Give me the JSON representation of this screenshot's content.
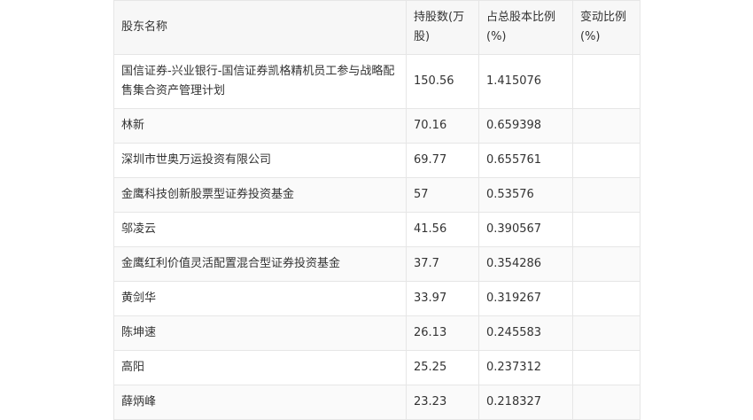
{
  "table": {
    "headers": [
      "股东名称",
      "持股数(万股)",
      "占总股本比例(%)",
      "变动比例(%)"
    ],
    "rows": [
      [
        "国信证券-兴业银行-国信证券凯格精机员工参与战略配售集合资产管理计划",
        "150.56",
        "1.415076",
        ""
      ],
      [
        "林新",
        "70.16",
        "0.659398",
        ""
      ],
      [
        "深圳市世奥万运投资有限公司",
        "69.77",
        "0.655761",
        ""
      ],
      [
        "金鹰科技创新股票型证券投资基金",
        "57",
        "0.53576",
        ""
      ],
      [
        "邬凌云",
        "41.56",
        "0.390567",
        ""
      ],
      [
        "金鹰红利价值灵活配置混合型证券投资基金",
        "37.7",
        "0.354286",
        ""
      ],
      [
        "黄剑华",
        "33.97",
        "0.319267",
        ""
      ],
      [
        "陈坤速",
        "26.13",
        "0.245583",
        ""
      ],
      [
        "高阳",
        "25.25",
        "0.237312",
        ""
      ],
      [
        "薛炳峰",
        "23.23",
        "0.218327",
        ""
      ]
    ]
  }
}
